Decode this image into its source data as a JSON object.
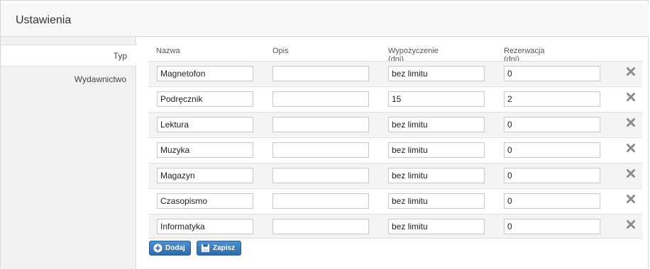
{
  "header": {
    "title": "Ustawienia"
  },
  "sidebar": {
    "items": [
      {
        "label": "Typ",
        "active": true
      },
      {
        "label": "Wydawnictwo",
        "active": false
      }
    ]
  },
  "table": {
    "columns": [
      "Nazwa",
      "Opis",
      "Wypożyczenie (dni)",
      "Rezerwacja (dni)"
    ],
    "rows": [
      {
        "nazwa": "Magnetofon",
        "opis": "",
        "wypozyczenie": "bez limitu",
        "rezerwacja": "0"
      },
      {
        "nazwa": "Podręcznik",
        "opis": "",
        "wypozyczenie": "15",
        "rezerwacja": "2"
      },
      {
        "nazwa": "Lektura",
        "opis": "",
        "wypozyczenie": "bez limitu",
        "rezerwacja": "0"
      },
      {
        "nazwa": "Muzyka",
        "opis": "",
        "wypozyczenie": "bez limitu",
        "rezerwacja": "0"
      },
      {
        "nazwa": "Magazyn",
        "opis": "",
        "wypozyczenie": "bez limitu",
        "rezerwacja": "0"
      },
      {
        "nazwa": "Czasopismo",
        "opis": "",
        "wypozyczenie": "bez limitu",
        "rezerwacja": "0"
      },
      {
        "nazwa": "Informatyka",
        "opis": "",
        "wypozyczenie": "bez limitu",
        "rezerwacja": "0"
      }
    ]
  },
  "actions": {
    "add_label": "Dodaj",
    "save_label": "Zapisz"
  },
  "colors": {
    "button": "#3b7bbf",
    "delete_icon": "#8c8c8c"
  }
}
